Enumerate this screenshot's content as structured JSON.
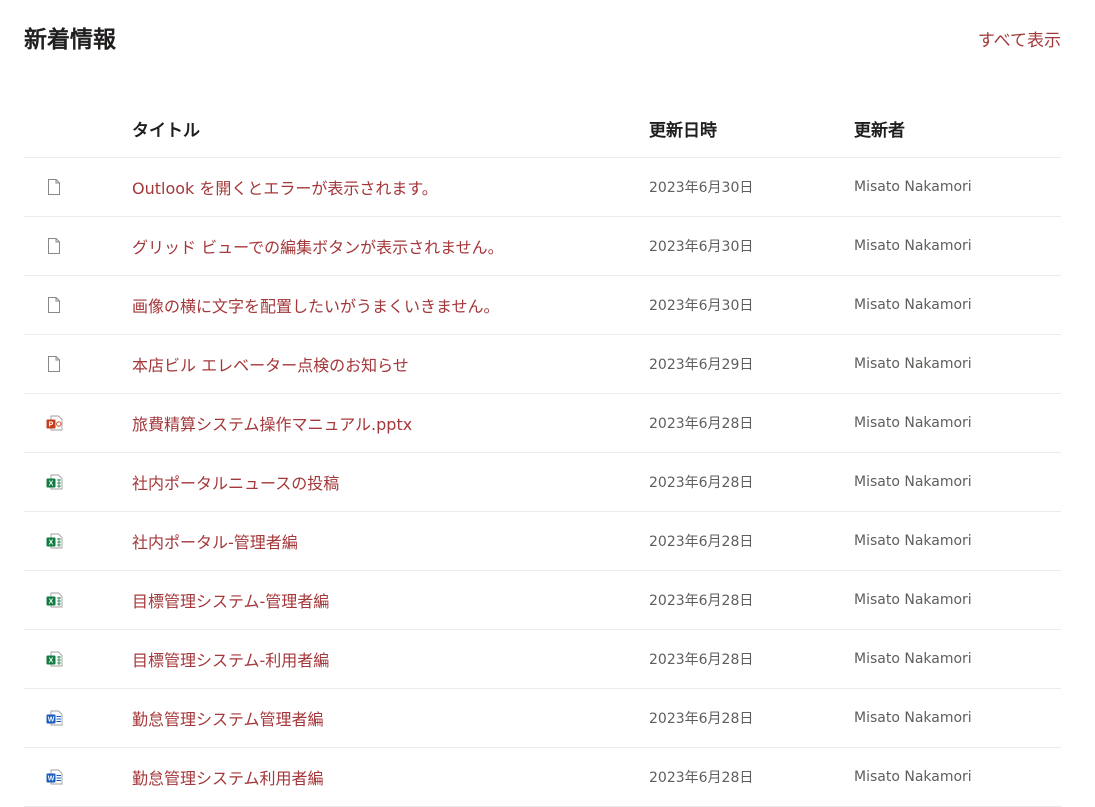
{
  "header": {
    "title": "新着情報",
    "see_all": "すべて表示"
  },
  "columns": {
    "icon": "",
    "title": "タイトル",
    "modified": "更新日時",
    "modified_by": "更新者"
  },
  "colors": {
    "accent": "#a4373a",
    "powerpoint": "#c43e1c",
    "excel": "#107c41",
    "word": "#185abd"
  },
  "items": [
    {
      "icon": "generic-document-icon",
      "type": "generic",
      "title": "Outlook を開くとエラーが表示されます。",
      "modified": "2023年6月30日",
      "modified_by": "Misato Nakamori"
    },
    {
      "icon": "generic-document-icon",
      "type": "generic",
      "title": "グリッド ビューでの編集ボタンが表示されません。",
      "modified": "2023年6月30日",
      "modified_by": "Misato Nakamori"
    },
    {
      "icon": "generic-document-icon",
      "type": "generic",
      "title": "画像の横に文字を配置したいがうまくいきません。",
      "modified": "2023年6月30日",
      "modified_by": "Misato Nakamori"
    },
    {
      "icon": "generic-document-icon",
      "type": "generic",
      "title": "本店ビル エレベーター点検のお知らせ",
      "modified": "2023年6月29日",
      "modified_by": "Misato Nakamori"
    },
    {
      "icon": "powerpoint-file-icon",
      "type": "powerpoint",
      "title": "旅費精算システム操作マニュアル.pptx",
      "modified": "2023年6月28日",
      "modified_by": "Misato Nakamori"
    },
    {
      "icon": "excel-file-icon",
      "type": "excel",
      "title": "社内ポータルニュースの投稿",
      "modified": "2023年6月28日",
      "modified_by": "Misato Nakamori"
    },
    {
      "icon": "excel-file-icon",
      "type": "excel",
      "title": "社内ポータル-管理者編",
      "modified": "2023年6月28日",
      "modified_by": "Misato Nakamori"
    },
    {
      "icon": "excel-file-icon",
      "type": "excel",
      "title": "目標管理システム-管理者編",
      "modified": "2023年6月28日",
      "modified_by": "Misato Nakamori"
    },
    {
      "icon": "excel-file-icon",
      "type": "excel",
      "title": "目標管理システム-利用者編",
      "modified": "2023年6月28日",
      "modified_by": "Misato Nakamori"
    },
    {
      "icon": "word-file-icon",
      "type": "word",
      "title": "勤怠管理システム管理者編",
      "modified": "2023年6月28日",
      "modified_by": "Misato Nakamori"
    },
    {
      "icon": "word-file-icon",
      "type": "word",
      "title": "勤怠管理システム利用者編",
      "modified": "2023年6月28日",
      "modified_by": "Misato Nakamori"
    }
  ]
}
